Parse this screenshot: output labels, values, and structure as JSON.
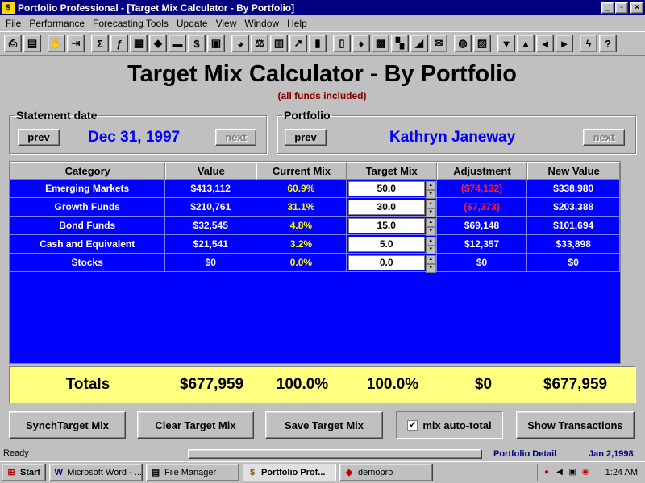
{
  "window": {
    "title": "Portfolio Professional - [Target Mix Calculator - By Portfolio]",
    "buttons": {
      "minimize": "_",
      "restore": "▫",
      "close": "×"
    }
  },
  "menu": [
    "File",
    "Performance",
    "Forecasting Tools",
    "Update",
    "View",
    "Window",
    "Help"
  ],
  "toolbar": {
    "icons": [
      "printer-icon",
      "print-preview-icon",
      "hand-icon",
      "door-icon",
      "sum-icon",
      "function-icon",
      "table-icon",
      "asset-icon",
      "bars-icon",
      "money-bag-icon",
      "clipboard-icon",
      "pie-chart-icon",
      "scale-icon",
      "calculator-icon",
      "line-chart-icon",
      "bar-chart-icon",
      "book-icon",
      "shield-icon",
      "grid-icon",
      "blocks-icon",
      "eraser-icon",
      "mail-icon",
      "globe-icon",
      "landscape-icon",
      "arrow-down-icon",
      "arrow-up-icon",
      "arrow-left-icon",
      "arrow-right-icon",
      "lightning-icon",
      "help-icon"
    ],
    "glyphs": [
      "⎙",
      "▤",
      "✋",
      "⇥",
      "Σ",
      "ƒ",
      "▦",
      "◆",
      "▬",
      "$",
      "▣",
      "◕",
      "⚖",
      "▥",
      "↗",
      "▮",
      "▯",
      "♦",
      "▩",
      "▚",
      "◢",
      "✉",
      "◍",
      "▨",
      "▼",
      "▲",
      "◄",
      "►",
      "ϟ",
      "?"
    ]
  },
  "header": {
    "title": "Target Mix Calculator - By Portfolio",
    "subtitle": "(all funds included)"
  },
  "statement": {
    "legend": "Statement date",
    "prev": "prev",
    "value": "Dec 31, 1997",
    "next": "next"
  },
  "portfolio": {
    "legend": "Portfolio",
    "prev": "prev",
    "value": "Kathryn Janeway",
    "next": "next"
  },
  "grid": {
    "columns": [
      "Category",
      "Value",
      "Current Mix",
      "Target Mix",
      "Adjustment",
      "New Value"
    ],
    "rows": [
      {
        "category": "Emerging Markets",
        "value": "$413,112",
        "current_mix": "60.9%",
        "target_mix": "50.0",
        "adjustment": "($74,132)",
        "new_value": "$338,980",
        "negative": true
      },
      {
        "category": "Growth Funds",
        "value": "$210,761",
        "current_mix": "31.1%",
        "target_mix": "30.0",
        "adjustment": "($7,373)",
        "new_value": "$203,388",
        "negative": true
      },
      {
        "category": "Bond Funds",
        "value": "$32,545",
        "current_mix": "4.8%",
        "target_mix": "15.0",
        "adjustment": "$69,148",
        "new_value": "$101,694",
        "negative": false
      },
      {
        "category": "Cash and Equivalent",
        "value": "$21,541",
        "current_mix": "3.2%",
        "target_mix": "5.0",
        "adjustment": "$12,357",
        "new_value": "$33,898",
        "negative": false
      },
      {
        "category": "Stocks",
        "value": "$0",
        "current_mix": "0.0%",
        "target_mix": "0.0",
        "adjustment": "$0",
        "new_value": "$0",
        "negative": false
      }
    ]
  },
  "totals": {
    "label": "Totals",
    "value": "$677,959",
    "current_mix": "100.0%",
    "target_mix": "100.0%",
    "adjustment": "$0",
    "new_value": "$677,959"
  },
  "actions": {
    "synch": "SynchTarget Mix",
    "clear": "Clear Target Mix",
    "save": "Save Target Mix",
    "auto_total": "mix auto-total",
    "auto_total_checked": true,
    "show_transactions": "Show Transactions"
  },
  "status": {
    "ready": "Ready",
    "area": "Portfolio Detail",
    "date": "Jan 2,1998"
  },
  "taskbar": {
    "start": "Start",
    "tasks": [
      "Microsoft Word - ...",
      "File Manager",
      "Portfolio Prof...",
      "demopro"
    ],
    "clock": "1:24 AM"
  },
  "colors": {
    "title_bar": "#000080",
    "grid_bg": "#0000ff",
    "mix_text": "#ffff00",
    "negative_text": "#ff2020",
    "totals_bg": "#ffff80",
    "value_text": "#0000ff",
    "subtitle_text": "#800000"
  }
}
